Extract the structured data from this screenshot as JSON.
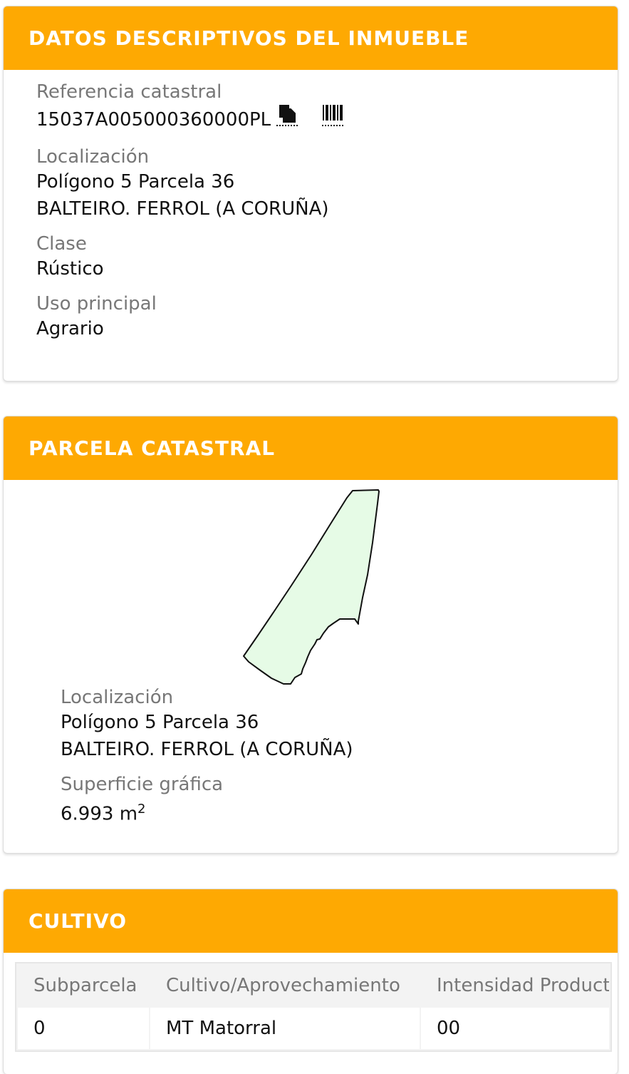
{
  "datos": {
    "title": "DATOS DESCRIPTIVOS DEL INMUEBLE",
    "ref_label": "Referencia catastral",
    "ref_value": "15037A005000360000PL",
    "loc_label": "Localización",
    "loc_line1": "Polígono 5 Parcela 36",
    "loc_line2": "BALTEIRO. FERROL (A CORUÑA)",
    "clase_label": "Clase",
    "clase_value": "Rústico",
    "uso_label": "Uso principal",
    "uso_value": "Agrario"
  },
  "parcela": {
    "title": "PARCELA CATASTRAL",
    "loc_label": "Localización",
    "loc_line1": "Polígono 5 Parcela 36",
    "loc_line2": "BALTEIRO. FERROL (A CORUÑA)",
    "sup_label": "Superficie gráfica",
    "sup_value": "6.993 m",
    "sup_exp": "2",
    "fill_color": "#e6fbe6",
    "stroke_color": "#111111"
  },
  "cultivo": {
    "title": "CULTIVO",
    "headers": [
      "Subparcela",
      "Cultivo/Aprovechamiento",
      "Intensidad Productiva"
    ],
    "rows": [
      [
        "0",
        "MT Matorral",
        "00"
      ]
    ]
  },
  "colors": {
    "header_bg": "#fea902",
    "header_text": "#ffffff"
  }
}
